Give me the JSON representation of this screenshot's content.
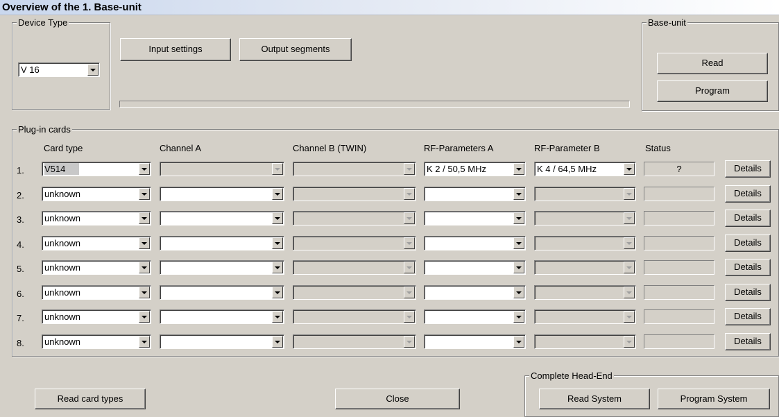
{
  "window": {
    "title": "Overview of the 1. Base-unit"
  },
  "device_type": {
    "label": "Device Type",
    "value": "V 16"
  },
  "buttons": {
    "input_settings": "Input settings",
    "output_segments": "Output segments",
    "read_card_types": "Read card types",
    "close": "Close"
  },
  "base_unit": {
    "label": "Base-unit",
    "read": "Read",
    "program": "Program"
  },
  "plugin_cards": {
    "label": "Plug-in cards",
    "headers": {
      "card_type": "Card type",
      "channel_a": "Channel A",
      "channel_b": "Channel B (TWIN)",
      "rf_a": "RF-Parameters A",
      "rf_b": "RF-Parameter B",
      "status": "Status"
    },
    "rows": [
      {
        "num": "1.",
        "card_type": "V514",
        "channel_a": "",
        "channel_b": "",
        "rf_a": "K 2 / 50,5 MHz",
        "rf_b": "K 4 / 64,5 MHz",
        "status": "?",
        "details": "Details"
      },
      {
        "num": "2.",
        "card_type": "unknown",
        "channel_a": "",
        "channel_b": "",
        "rf_a": "",
        "rf_b": "",
        "status": "",
        "details": "Details"
      },
      {
        "num": "3.",
        "card_type": "unknown",
        "channel_a": "",
        "channel_b": "",
        "rf_a": "",
        "rf_b": "",
        "status": "",
        "details": "Details"
      },
      {
        "num": "4.",
        "card_type": "unknown",
        "channel_a": "",
        "channel_b": "",
        "rf_a": "",
        "rf_b": "",
        "status": "",
        "details": "Details"
      },
      {
        "num": "5.",
        "card_type": "unknown",
        "channel_a": "",
        "channel_b": "",
        "rf_a": "",
        "rf_b": "",
        "status": "",
        "details": "Details"
      },
      {
        "num": "6.",
        "card_type": "unknown",
        "channel_a": "",
        "channel_b": "",
        "rf_a": "",
        "rf_b": "",
        "status": "",
        "details": "Details"
      },
      {
        "num": "7.",
        "card_type": "unknown",
        "channel_a": "",
        "channel_b": "",
        "rf_a": "",
        "rf_b": "",
        "status": "",
        "details": "Details"
      },
      {
        "num": "8.",
        "card_type": "unknown",
        "channel_a": "",
        "channel_b": "",
        "rf_a": "",
        "rf_b": "",
        "status": "",
        "details": "Details"
      }
    ]
  },
  "head_end": {
    "label": "Complete Head-End",
    "read_system": "Read System",
    "program_system": "Program System"
  }
}
